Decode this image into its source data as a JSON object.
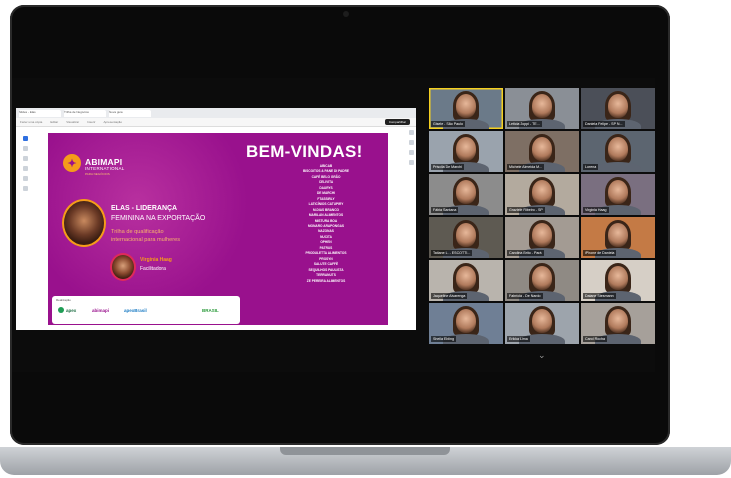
{
  "slide": {
    "heading": "BEM-VINDAS!",
    "logo": {
      "name": "ABIMAPI",
      "subtitle": "INTERNATIONAL",
      "tagline": "PARA NEGÓCIOS"
    },
    "program_line1": "ELAS - LIDERANÇA",
    "program_line2": "FEMININA NA EXPORTAÇÃO",
    "trail_line1": "Trilha de qualificação",
    "trail_line2": "internacional para mulheres",
    "facilitator_name": "Virgínia Haag",
    "facilitator_role": "Facilitadora",
    "sponsor_label": "Realização",
    "sponsors": [
      "apex",
      "abimapi",
      "apexBrasil",
      "BRASIL"
    ],
    "companies": [
      "ABICAB",
      "BISCOITOS & PANE DI PADRE",
      "CAFÉ BELO GRÃO",
      "CELIVITA",
      "DAURYS",
      "DE MARCHI",
      "FTASSIRLY",
      "LATICÍNIOS CATUPIRY",
      "M.DIAS BRANCO",
      "MARILAN ALIMENTOS",
      "MISTURA BOA",
      "MONARO ARAPONGAS",
      "NAZONAS",
      "NUCITA",
      "OPHEN",
      "PATRUS",
      "PRODULETTA ALIMENTOS",
      "PROSYN",
      "SALUTE CAFFÈ",
      "SEQUILHOS PAULISTA",
      "TERRANUTS",
      "ZE PEREIRA ALIMENTOS"
    ]
  },
  "browser": {
    "tabs": [
      "Slides - Elas",
      "Trilha de Negócios",
      "Nova guia"
    ],
    "menu": [
      "Fazer uma cópia",
      "Editar",
      "Visualizar",
      "Inserir",
      "Apresentação"
    ],
    "share_label": "Compartilhar"
  },
  "participants": [
    {
      "name": "Gisele - São Paulo"
    },
    {
      "name": "Leticia Joppi - TE..."
    },
    {
      "name": "Daniela Felipe - SP N..."
    },
    {
      "name": "Priscila De Marchi"
    },
    {
      "name": "Michele Almeida M..."
    },
    {
      "name": "Lorena"
    },
    {
      "name": "Fábia Santana"
    },
    {
      "name": "Graziele Ribeiro - SP"
    },
    {
      "name": "Virginia Haag"
    },
    {
      "name": "Tatiane L. - ESCOTTI..."
    },
    {
      "name": "Carolina Brito - Pará"
    },
    {
      "name": "iPhone de Daniela"
    },
    {
      "name": "Jaqueline Alvarenga"
    },
    {
      "name": "Fabrícia - De Nardo"
    },
    {
      "name": "Daiane Stesmann"
    },
    {
      "name": "Sheila Ebling"
    },
    {
      "name": "Erikka Lima"
    },
    {
      "name": "Carol Rocha"
    }
  ],
  "colors": {
    "slide_bg": "#99118d",
    "accent_orange": "#f59c1a",
    "active_speaker": "#f5d020"
  }
}
